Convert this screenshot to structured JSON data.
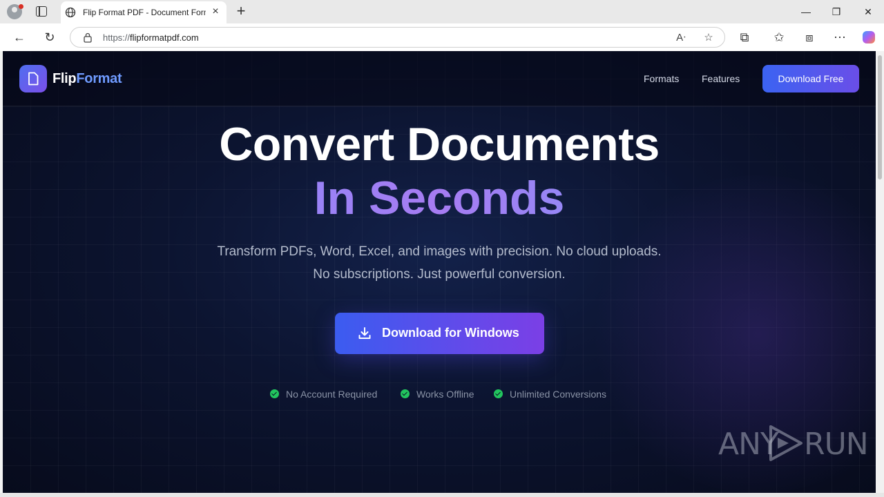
{
  "browser": {
    "tab_title": "Flip Format PDF - Document Form",
    "url_scheme": "https://",
    "url_host": "flipformatpdf.com"
  },
  "site": {
    "logo_part1": "Flip",
    "logo_part2": "Format",
    "nav": [
      "Formats",
      "Features"
    ],
    "nav_cta": "Download Free"
  },
  "hero": {
    "title": "Convert Documents",
    "subtitle": "In Seconds",
    "description": "Transform PDFs, Word, Excel, and images with precision. No cloud uploads. No subscriptions. Just powerful conversion.",
    "cta_label": "Download for Windows"
  },
  "features": [
    "No Account Required",
    "Works Offline",
    "Unlimited Conversions"
  ],
  "watermark": {
    "left": "ANY",
    "right": "RUN"
  },
  "colors": {
    "accent_blue": "#3b5cf0",
    "accent_purple": "#7b3fe6",
    "check_green": "#22c55e",
    "page_bg": "#0c1430"
  },
  "icons": {
    "tab": "globe-icon",
    "lock": "lock-icon",
    "cta": "download-icon",
    "logo": "document-icon"
  }
}
